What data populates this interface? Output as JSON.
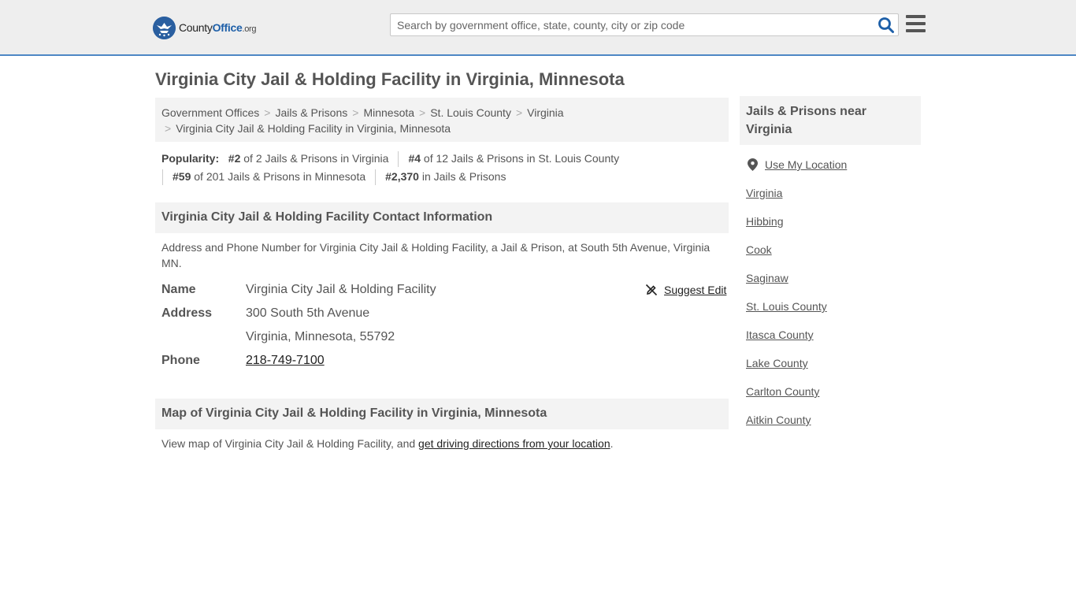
{
  "header": {
    "logo": {
      "county": "County",
      "office": "Office",
      "org": ".org"
    },
    "search_placeholder": "Search by government office, state, county, city or zip code"
  },
  "page_title": "Virginia City Jail & Holding Facility in Virginia, Minnesota",
  "breadcrumb": [
    "Government Offices",
    "Jails & Prisons",
    "Minnesota",
    "St. Louis County",
    "Virginia",
    "Virginia City Jail & Holding Facility in Virginia, Minnesota"
  ],
  "popularity": {
    "label": "Popularity:",
    "items": [
      {
        "rank": "#2",
        "text": "of 2 Jails & Prisons in Virginia"
      },
      {
        "rank": "#4",
        "text": "of 12 Jails & Prisons in St. Louis County"
      },
      {
        "rank": "#59",
        "text": "of 201 Jails & Prisons in Minnesota"
      },
      {
        "rank": "#2,370",
        "text": "in Jails & Prisons"
      }
    ]
  },
  "contact": {
    "heading": "Virginia City Jail & Holding Facility Contact Information",
    "description": "Address and Phone Number for Virginia City Jail & Holding Facility, a Jail & Prison, at South 5th Avenue, Virginia MN.",
    "name_label": "Name",
    "name_value": "Virginia City Jail & Holding Facility",
    "address_label": "Address",
    "address_line1": "300 South 5th Avenue",
    "address_line2": "Virginia, Minnesota, 55792",
    "phone_label": "Phone",
    "phone_value": "218-749-7100",
    "suggest_edit": "Suggest Edit"
  },
  "map": {
    "heading": "Map of Virginia City Jail & Holding Facility in Virginia, Minnesota",
    "text_before": "View map of Virginia City Jail & Holding Facility, and ",
    "link": "get driving directions from your location",
    "text_after": "."
  },
  "sidebar": {
    "heading": "Jails & Prisons near Virginia",
    "use_location": "Use My Location",
    "links": [
      "Virginia",
      "Hibbing",
      "Cook",
      "Saginaw",
      "St. Louis County",
      "Itasca County",
      "Lake County",
      "Carlton County",
      "Aitkin County"
    ]
  },
  "colors": {
    "accent": "#4e87c4",
    "logo_blue": "#2a5fa0",
    "panel": "#f3f3f3",
    "header_bg": "#eeeeee"
  }
}
